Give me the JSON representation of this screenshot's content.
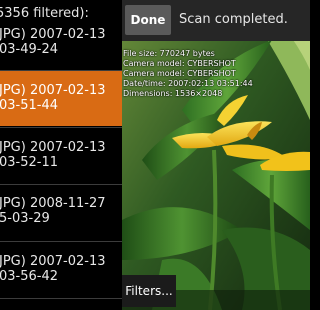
{
  "list": {
    "header": "5356 filtered):",
    "items": [
      {
        "line1": "JPG) 2007-02-13",
        "line2": "03-49-24",
        "selected": false
      },
      {
        "line1": "JPG) 2007-02-13",
        "line2": "03-51-44",
        "selected": true
      },
      {
        "line1": "JPG) 2007-02-13",
        "line2": "03-52-11",
        "selected": false
      },
      {
        "line1": "JPG) 2008-11-27",
        "line2": " 5-03-29",
        "selected": false
      },
      {
        "line1": "JPG) 2007-02-13",
        "line2": "03-56-42",
        "selected": false
      }
    ]
  },
  "toolbar": {
    "done_label": "Done",
    "status": "Scan completed."
  },
  "info": {
    "file_size": "File size: 770247 bytes",
    "camera_model_1": "Camera model: CYBERSHOT",
    "camera_model_2": "Camera model: CYBERSHOT",
    "date_time": "Date/time: 2007:02:13 03:51:44",
    "dimensions": "Dimensions: 1536×2048"
  },
  "filters_label": "Filters...",
  "colors": {
    "selected_item": "#d96b14",
    "toolbar_bg": "#262626",
    "button_bg": "#5a5a5a",
    "flower_yellow": "#f2c21a",
    "leaf_green": "#3f8a2a"
  }
}
